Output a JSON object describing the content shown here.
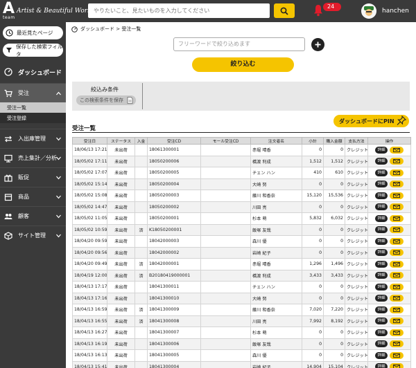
{
  "header": {
    "logo_letter": "A",
    "logo_sub": "team",
    "tagline": "Artist & Beautiful World",
    "search_placeholder": "やりたいこと、見たいものを入力してください",
    "notification_count": "24",
    "username": "hanchen"
  },
  "sidebar": {
    "recent_pages": "最近見たページ",
    "saved_filters": "保存した検索フィルタ",
    "dashboard": "ダッシュボード",
    "orders": "受注",
    "order_list": "受注一覧",
    "order_register": "受注登録",
    "items": [
      {
        "label": "入出庫管理"
      },
      {
        "label": "売上集計／分析"
      },
      {
        "label": "販促"
      },
      {
        "label": "商品"
      },
      {
        "label": "顧客"
      },
      {
        "label": "サイト管理"
      }
    ]
  },
  "main": {
    "breadcrumb": "ダッシュボード > 受注一覧",
    "free_word_placeholder": "フリーワードで絞り込めます",
    "narrow_button": "絞り込む",
    "conditions_title": "絞込み条件",
    "save_condition": "この検索条件を保存",
    "pin_button": "ダッシュボードにPIN",
    "section_title": "受注一覧",
    "detail_label": "詳細",
    "columns": [
      "受注日",
      "ステータス",
      "入金",
      "受注CD",
      "モール受注CD",
      "注文者名",
      "小計",
      "購入金額",
      "支払方法",
      "操作"
    ],
    "rows": [
      [
        "18/06/13 17:21",
        "未出荷",
        "",
        "18061300001",
        "",
        "赤堀 晴香",
        "0",
        "0",
        "クレジット"
      ],
      [
        "18/05/02 17:11",
        "未出荷",
        "",
        "18050200006",
        "",
        "橋渡 利成",
        "1,512",
        "1,512",
        "クレジット"
      ],
      [
        "18/05/02 17:07",
        "未出荷",
        "",
        "18050200005",
        "",
        "チェン ハン",
        "410",
        "610",
        "クレジット"
      ],
      [
        "18/05/02 15:14",
        "未出荷",
        "",
        "18050200004",
        "",
        "大崎 努",
        "0",
        "0",
        "クレジット"
      ],
      [
        "18/05/02 15:08",
        "未出荷",
        "",
        "18050200003",
        "",
        "藤川 和香奈",
        "15,120",
        "15,536",
        "クレジット"
      ],
      [
        "18/05/02 14:47",
        "未出荷",
        "",
        "18050200002",
        "",
        "川田 亮",
        "0",
        "0",
        "クレジット"
      ],
      [
        "18/05/02 11:05",
        "未出荷",
        "",
        "18050200001",
        "",
        "杉本 萌",
        "5,832",
        "6,032",
        "クレジット"
      ],
      [
        "18/05/02 10:59",
        "未出荷",
        "済",
        "K18050200001",
        "",
        "飯塚 友哉",
        "0",
        "0",
        "クレジット"
      ],
      [
        "18/04/20 09:59",
        "未出荷",
        "",
        "18042000003",
        "",
        "森川 優",
        "0",
        "0",
        "クレジット"
      ],
      [
        "18/04/20 09:56",
        "未出荷",
        "",
        "18042000002",
        "",
        "岩崎 紀子",
        "0",
        "0",
        "クレジット"
      ],
      [
        "18/04/20 09:49",
        "未出荷",
        "済",
        "18042000001",
        "",
        "赤堀 晴香",
        "1,296",
        "1,496",
        "クレジット"
      ],
      [
        "18/04/19 12:00",
        "未出荷",
        "済",
        "B20180419000001",
        "",
        "橋渡 利成",
        "3,433",
        "3,433",
        "クレジット"
      ],
      [
        "18/04/13 17:17",
        "未出荷",
        "",
        "18041300011",
        "",
        "チェン ハン",
        "0",
        "0",
        "クレジット"
      ],
      [
        "18/04/13 17:16",
        "未出荷",
        "",
        "18041300010",
        "",
        "大崎 努",
        "0",
        "0",
        "クレジット"
      ],
      [
        "18/04/13 16:59",
        "未出荷",
        "済",
        "18041300009",
        "",
        "藤川 和香奈",
        "7,020",
        "7,220",
        "クレジット"
      ],
      [
        "18/04/13 16:55",
        "未出荷",
        "済",
        "18041300008",
        "",
        "川田 亮",
        "7,992",
        "8,192",
        "クレジット"
      ],
      [
        "18/04/13 16:27",
        "未出荷",
        "",
        "18041300007",
        "",
        "杉本 萌",
        "0",
        "0",
        "クレジット"
      ],
      [
        "18/04/13 16:19",
        "未出荷",
        "",
        "18041300006",
        "",
        "飯塚 友哉",
        "0",
        "0",
        "クレジット"
      ],
      [
        "18/04/13 16:13",
        "未出荷",
        "",
        "18041300005",
        "",
        "森川 優",
        "0",
        "0",
        "クレジット"
      ],
      [
        "18/04/13 15:41",
        "未出荷",
        "",
        "18041300004",
        "",
        "岩崎 紀子",
        "14,904",
        "15,104",
        "クレジット"
      ]
    ]
  },
  "colors": {
    "accent": "#f5c400",
    "dark": "#3a3a3a",
    "badge": "#e21c2b"
  }
}
